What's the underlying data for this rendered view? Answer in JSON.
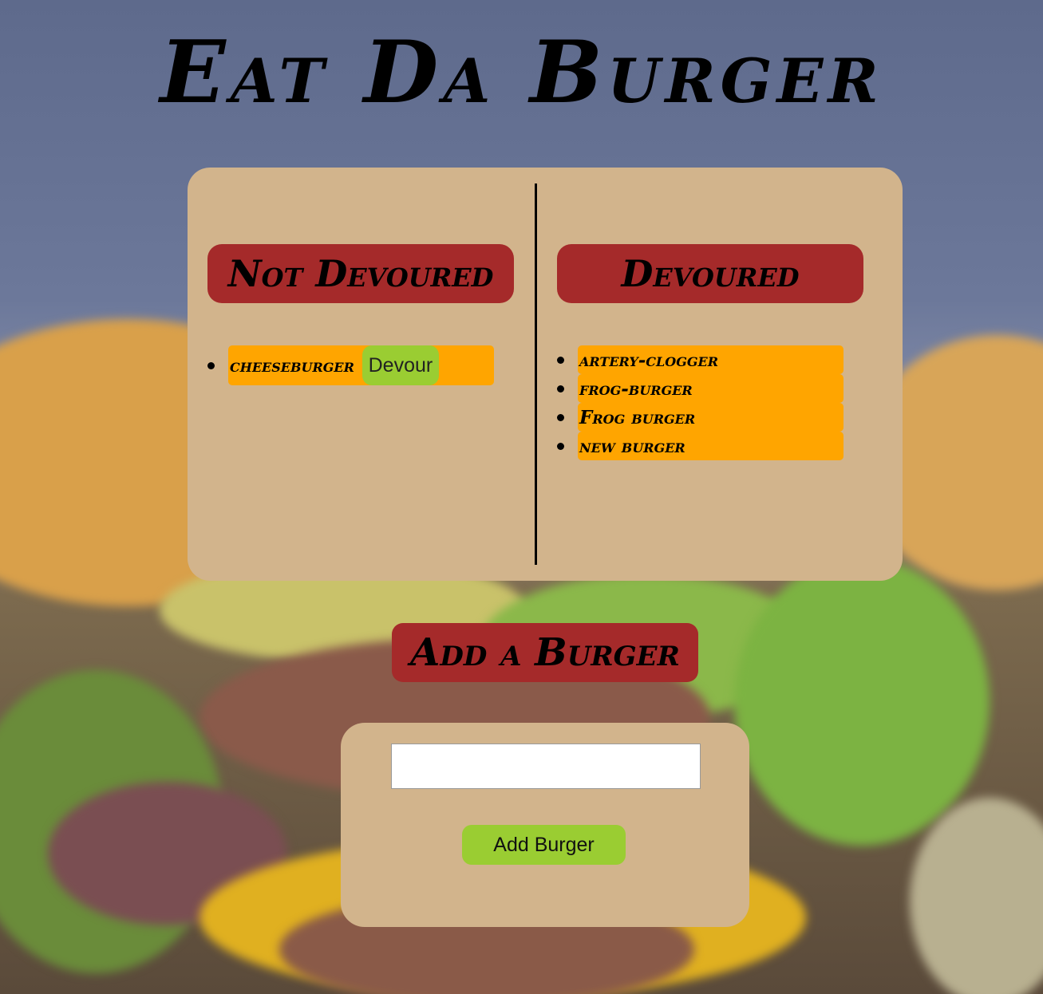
{
  "page": {
    "title": "Eat Da Burger"
  },
  "not_devoured": {
    "heading": "Not Devoured",
    "items": [
      {
        "name": "cheeseburger",
        "button_label": "Devour"
      }
    ]
  },
  "devoured": {
    "heading": "Devoured",
    "items": [
      {
        "name": "artery-clogger"
      },
      {
        "name": "frog-burger"
      },
      {
        "name": "Frog burger"
      },
      {
        "name": "new burger"
      }
    ]
  },
  "add_form": {
    "heading": "Add a Burger",
    "input_value": "",
    "input_placeholder": "",
    "submit_label": "Add Burger"
  },
  "colors": {
    "panel": "#d2b48c",
    "heading_bg": "#a52a2a",
    "item_bg": "#ffa500",
    "button_bg": "#9acd32"
  }
}
